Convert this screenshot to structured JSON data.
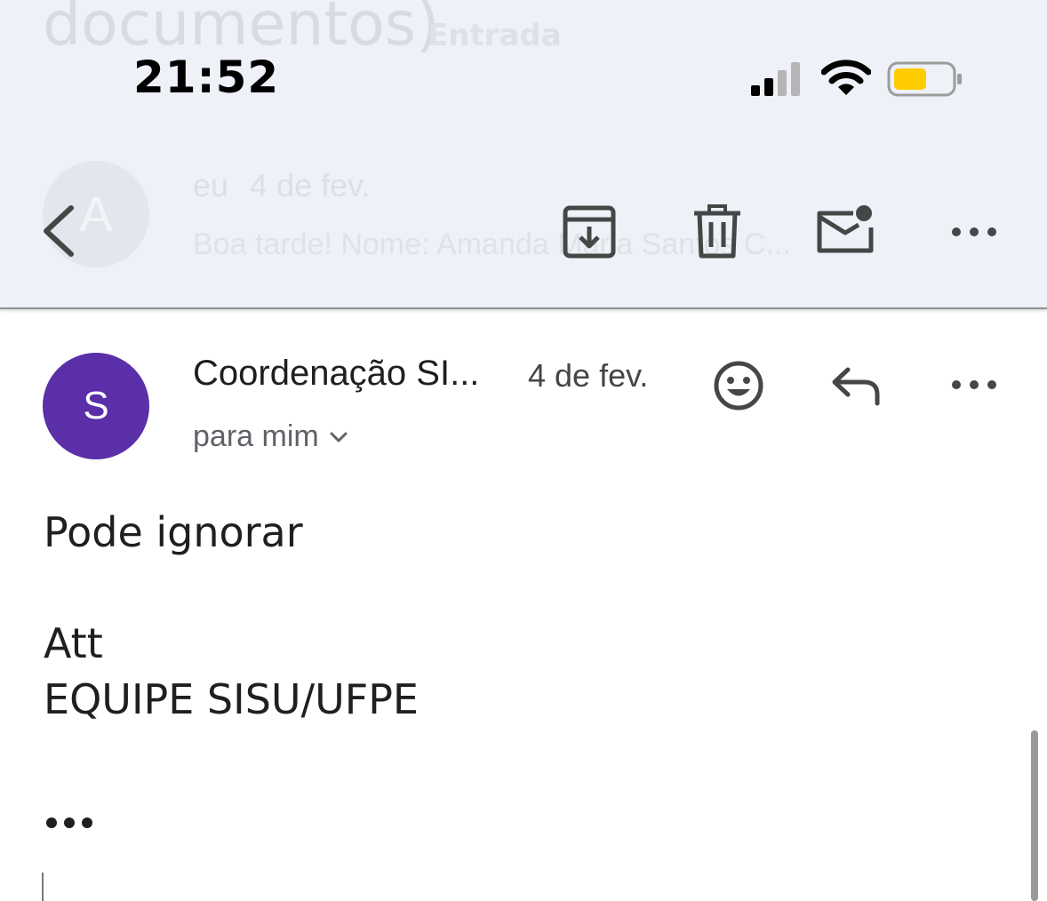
{
  "background_header": {
    "title": "documentos)",
    "label": "Entrada",
    "prev_message": {
      "avatar_letter": "A",
      "from": "eu",
      "date": "4 de fev.",
      "snippet": "Boa tarde! Nome: Amanda Maria Santos C..."
    }
  },
  "status_bar": {
    "time": "21:52",
    "battery_color": "#ffcc00"
  },
  "toolbar": {
    "icons": [
      "back-icon",
      "archive-icon",
      "trash-icon",
      "mark-unread-icon",
      "more-icon"
    ]
  },
  "message": {
    "avatar_letter": "S",
    "avatar_color": "#5a2fa8",
    "sender": "Coordenação SI...",
    "date": "4 de fev.",
    "recipient": "para mim",
    "actions": [
      "emoji-icon",
      "reply-icon",
      "more-icon"
    ],
    "body": {
      "line1": "Pode ignorar",
      "line2": "Att",
      "line3": "EQUIPE SISU/UFPE"
    }
  }
}
